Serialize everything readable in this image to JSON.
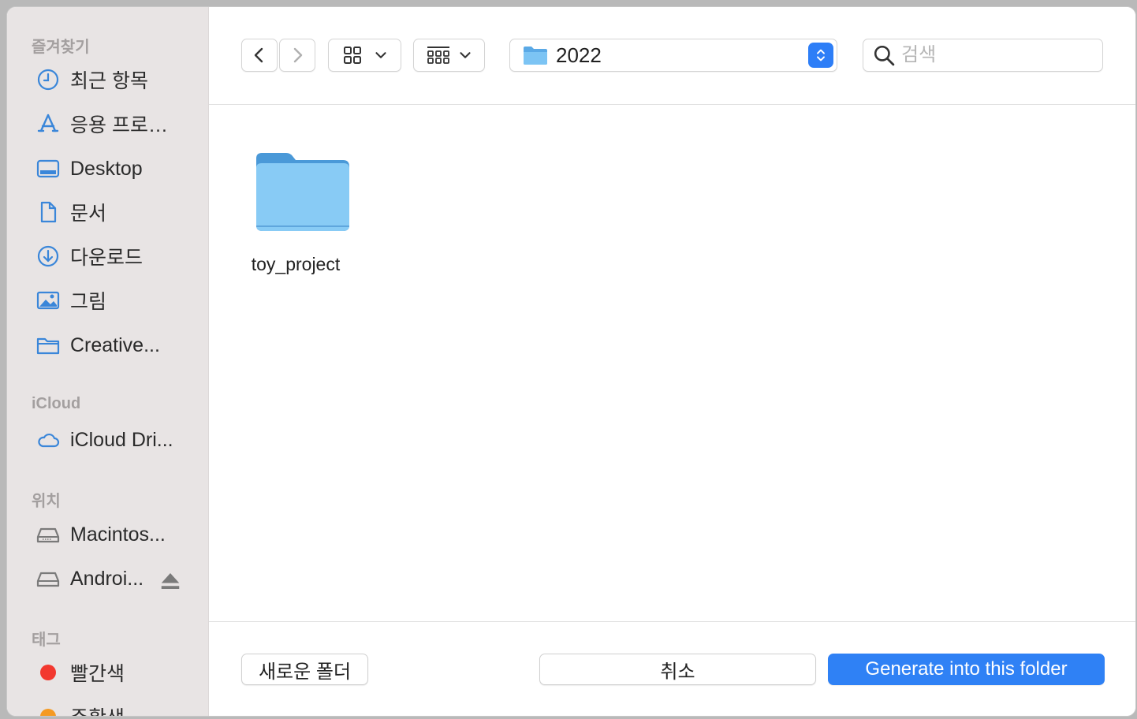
{
  "sidebar": {
    "favorites_title": "즐겨찾기",
    "favorites": [
      {
        "label": "최근 항목",
        "icon": "clock-icon"
      },
      {
        "label": "응용 프로…",
        "icon": "app-store-icon"
      },
      {
        "label": "Desktop",
        "icon": "desktop-icon"
      },
      {
        "label": "문서",
        "icon": "document-icon"
      },
      {
        "label": "다운로드",
        "icon": "download-icon"
      },
      {
        "label": "그림",
        "icon": "picture-icon"
      },
      {
        "label": "Creative...",
        "icon": "folder-icon"
      }
    ],
    "icloud_title": "iCloud",
    "icloud": [
      {
        "label": "iCloud Dri...",
        "icon": "cloud-icon"
      }
    ],
    "locations_title": "위치",
    "locations": [
      {
        "label": "Macintos...",
        "icon": "drive-icon"
      },
      {
        "label": "Androi...",
        "icon": "drive-icon"
      }
    ],
    "tags_title": "태그",
    "tags": [
      {
        "label": "빨간색",
        "color": "#f2382f"
      },
      {
        "label": "주황색",
        "color": "#f59a23"
      }
    ]
  },
  "toolbar": {
    "current_folder": "2022",
    "search_placeholder": "검색"
  },
  "content": {
    "items": [
      {
        "name": "toy_project",
        "type": "folder"
      }
    ]
  },
  "footer": {
    "new_folder_label": "새로운 폴더",
    "cancel_label": "취소",
    "confirm_label": "Generate into this folder"
  },
  "colors": {
    "accent": "#2f81f5",
    "sidebar_icon": "#3a86d9",
    "folder": "#7cc4f4"
  }
}
